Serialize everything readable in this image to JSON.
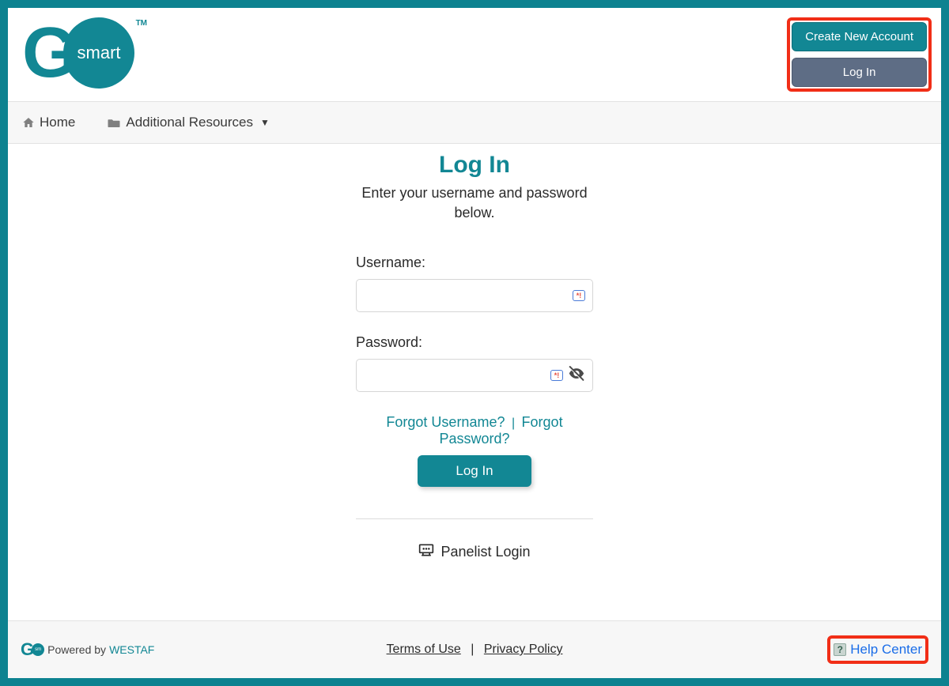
{
  "logo": {
    "letter": "G",
    "circle_text": "smart",
    "tm": "TM"
  },
  "header_buttons": {
    "create_account": "Create New Account",
    "login": "Log In"
  },
  "nav": {
    "home": "Home",
    "additional_resources": "Additional Resources"
  },
  "page": {
    "title": "Log In",
    "subtitle": "Enter your username and password below."
  },
  "form": {
    "username_label": "Username:",
    "password_label": "Password:",
    "forgot_username": "Forgot Username?",
    "forgot_password": "Forgot Password?",
    "login_button": "Log In",
    "badge_text": "*!"
  },
  "panelist": {
    "label": "Panelist Login"
  },
  "footer": {
    "powered_by": "Powered by ",
    "westaf": "WESTAF",
    "terms": "Terms of Use",
    "privacy": "Privacy Policy",
    "help_center": "Help Center",
    "help_icon_char": "?"
  }
}
